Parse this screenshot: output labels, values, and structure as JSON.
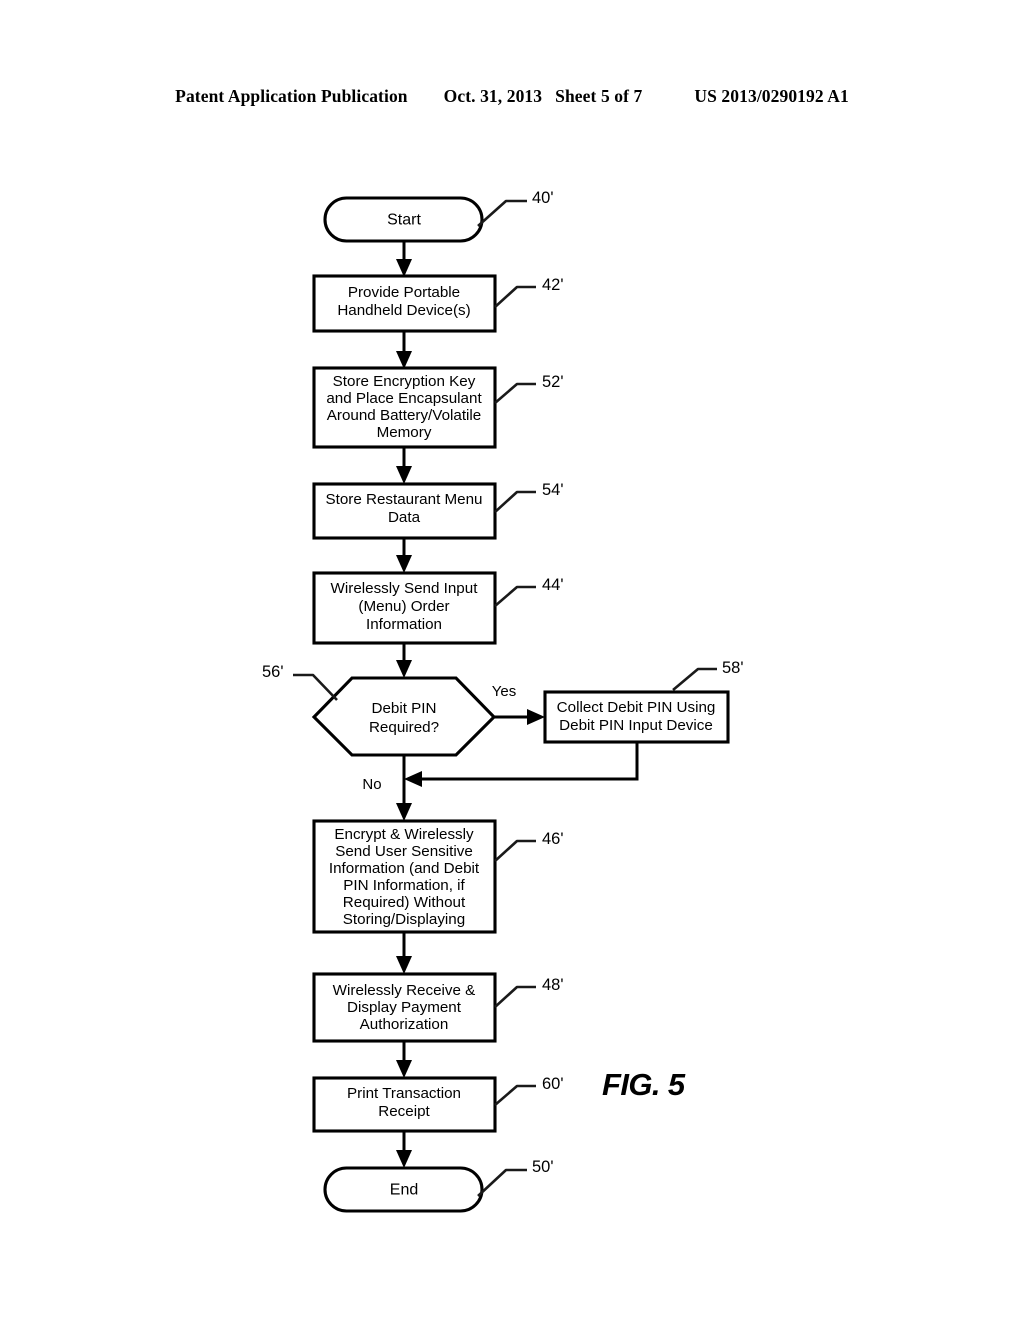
{
  "header": {
    "publication": "Patent Application Publication",
    "date": "Oct. 31, 2013",
    "sheet": "Sheet 5 of 7",
    "patent_number": "US 2013/0290192 A1"
  },
  "figure": {
    "label": "FIG. 5",
    "nodes": [
      {
        "id": "start",
        "ref": "40'",
        "type": "terminal",
        "lines": [
          "Start"
        ]
      },
      {
        "id": "provide",
        "ref": "42'",
        "type": "process",
        "lines": [
          "Provide Portable",
          "Handheld Device(s)"
        ]
      },
      {
        "id": "store_key",
        "ref": "52'",
        "type": "process",
        "lines": [
          "Store Encryption Key",
          "and Place Encapsulant",
          "Around Battery/Volatile",
          "Memory"
        ]
      },
      {
        "id": "store_menu",
        "ref": "54'",
        "type": "process",
        "lines": [
          "Store Restaurant Menu",
          "Data"
        ]
      },
      {
        "id": "send_order",
        "ref": "44'",
        "type": "process",
        "lines": [
          "Wirelessly Send Input",
          "(Menu) Order",
          "Information"
        ]
      },
      {
        "id": "debit_pin",
        "ref": "56'",
        "type": "decision",
        "lines": [
          "Debit PIN",
          "Required?"
        ]
      },
      {
        "id": "collect_pin",
        "ref": "58'",
        "type": "process",
        "lines": [
          "Collect Debit PIN Using",
          "Debit PIN Input Device"
        ]
      },
      {
        "id": "encrypt_send",
        "ref": "46'",
        "type": "process",
        "lines": [
          "Encrypt & Wirelessly",
          "Send User Sensitive",
          "Information (and Debit",
          "PIN Information, if",
          "Required) Without",
          "Storing/Displaying"
        ]
      },
      {
        "id": "receive_auth",
        "ref": "48'",
        "type": "process",
        "lines": [
          "Wirelessly Receive &",
          "Display Payment",
          "Authorization"
        ]
      },
      {
        "id": "print_receipt",
        "ref": "60'",
        "type": "process",
        "lines": [
          "Print Transaction",
          "Receipt"
        ]
      },
      {
        "id": "end",
        "ref": "50'",
        "type": "terminal",
        "lines": [
          "End"
        ]
      }
    ],
    "edge_labels": {
      "yes": "Yes",
      "no": "No"
    },
    "colors": {
      "stroke": "#000000",
      "fill": "#ffffff",
      "text": "#000000"
    }
  }
}
